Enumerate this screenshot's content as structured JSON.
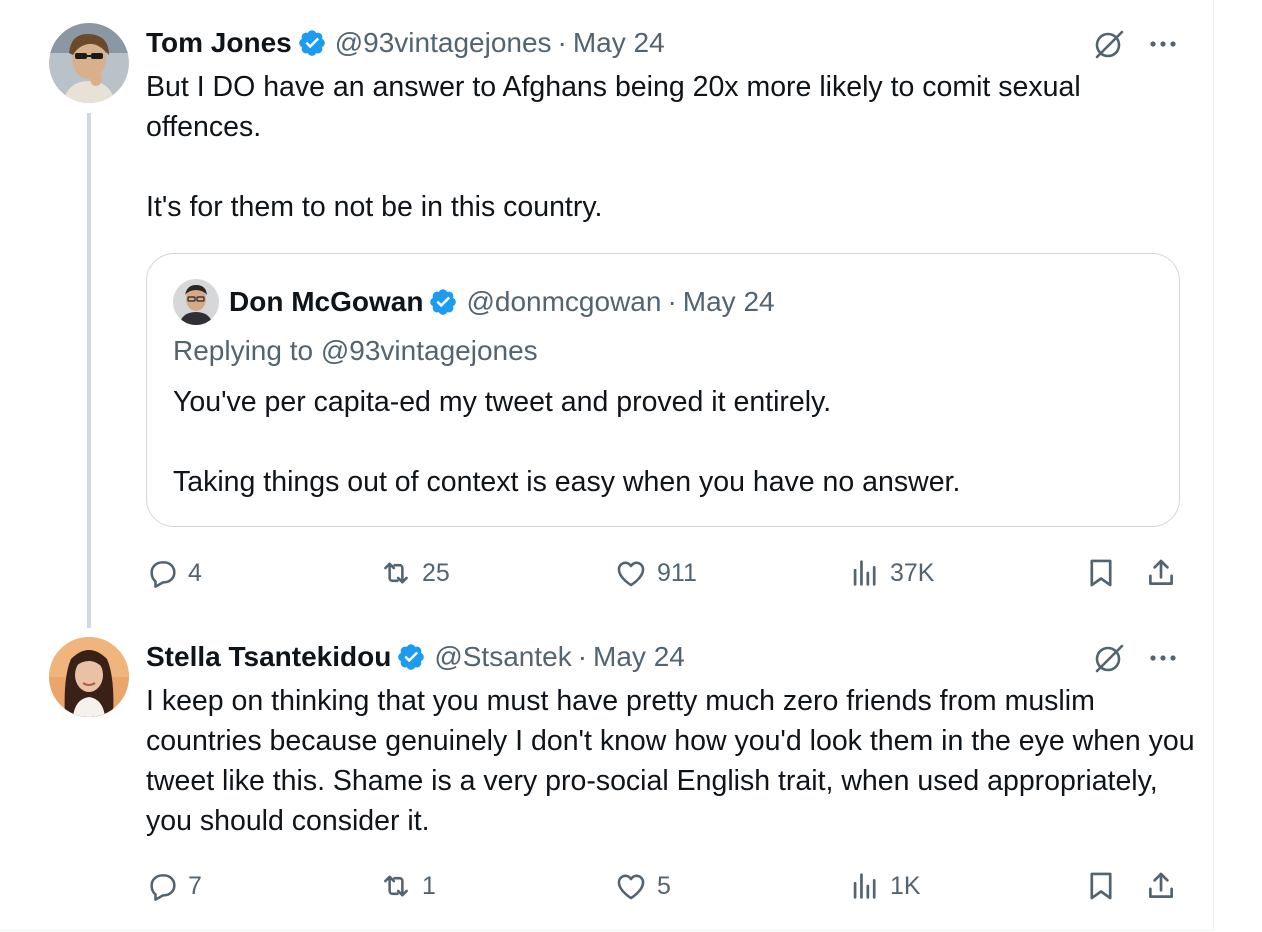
{
  "colors": {
    "verified_badge": "#1d9bf0",
    "secondary_text": "#536471",
    "primary_text": "#0f1419",
    "thread_line": "#cfd9de"
  },
  "tweets": [
    {
      "author_name": "Tom Jones",
      "handle": "@93vintagejones",
      "separator": "·",
      "date": "May 24",
      "avatar_icon": "user-avatar",
      "text_paragraphs": [
        "But I DO have an answer to Afghans being 20x more likely to comit sexual offences.",
        "It's for them to not be in this country."
      ],
      "quote": {
        "author_name": "Don McGowan",
        "handle": "@donmcgowan",
        "separator": "·",
        "date": "May 24",
        "replying_to": "Replying to @93vintagejones",
        "text_paragraphs": [
          "You've per capita-ed my tweet and proved it entirely.",
          "Taking things out of context is easy when you have no answer."
        ]
      },
      "stats": {
        "replies": "4",
        "reposts": "25",
        "likes": "911",
        "views": "37K"
      }
    },
    {
      "author_name": "Stella Tsantekidou",
      "handle": "@Stsantek",
      "separator": "·",
      "date": "May 24",
      "avatar_icon": "user-avatar",
      "text_paragraphs": [
        "I keep on thinking that you must have pretty much zero friends from muslim countries because genuinely I don't know how you'd look them in the eye when you tweet like this. Shame is a very pro-social English trait, when used appropriately, you should consider it."
      ],
      "stats": {
        "replies": "7",
        "reposts": "1",
        "likes": "5",
        "views": "1K"
      }
    }
  ]
}
